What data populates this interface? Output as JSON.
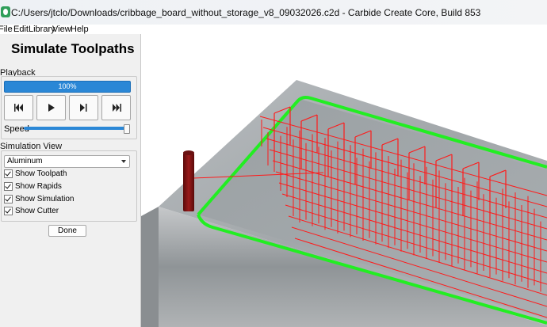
{
  "window": {
    "title": "C:/Users/jtclo/Downloads/cribbage_board_without_storage_v8_09032026.c2d - Carbide Create Core, Build 853"
  },
  "menu": [
    "File",
    "Edit",
    "Library",
    "View",
    "Help"
  ],
  "panel": {
    "title": "Simulate Toolpaths",
    "playback_label": "Playback",
    "progress_text": "100%",
    "progress_value": 1.0,
    "speed_label": "Speed",
    "speed_value": 1.0,
    "simulation_view_label": "Simulation View",
    "material": "Aluminum",
    "options": [
      {
        "label": "Show Toolpath",
        "checked": true
      },
      {
        "label": "Show Rapids",
        "checked": true
      },
      {
        "label": "Show Simulation",
        "checked": true
      },
      {
        "label": "Show Cutter",
        "checked": true
      }
    ],
    "done_label": "Done"
  },
  "buttons": {
    "rewind": "skip-back-icon",
    "play": "play-icon",
    "step": "step-forward-icon",
    "forward": "skip-forward-icon"
  },
  "colors": {
    "toolpath": "#ff1a1a",
    "outline": "#22ee22",
    "stock": "#9ea3a6",
    "progress": "#2a87d6"
  }
}
